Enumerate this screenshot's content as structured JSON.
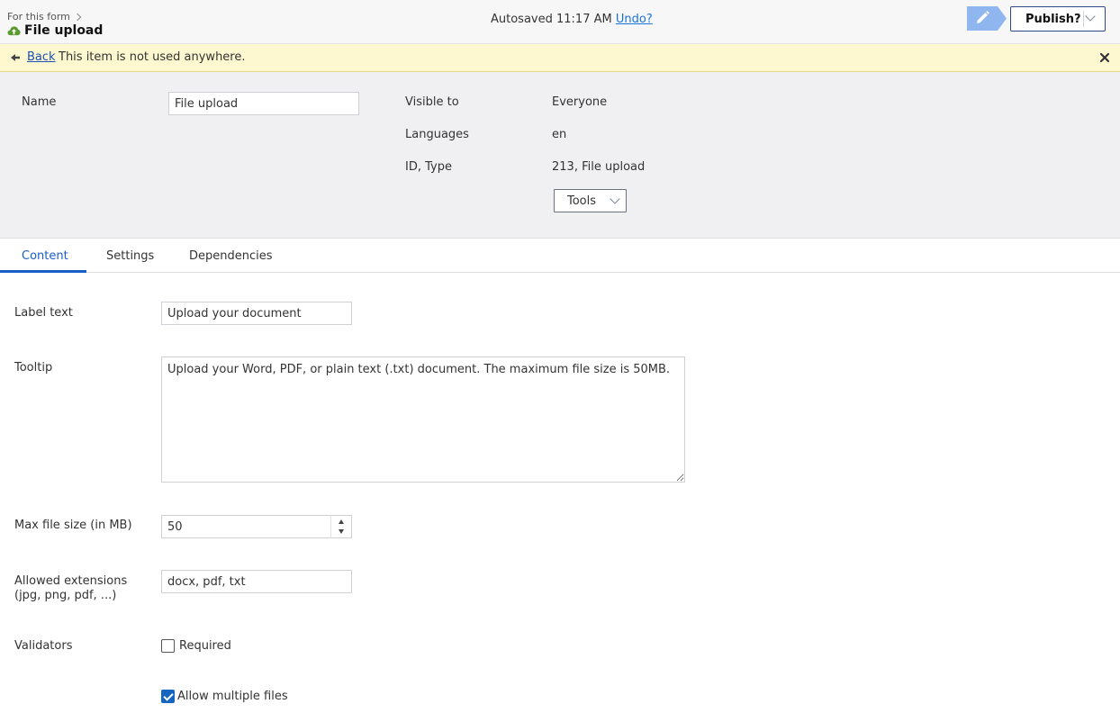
{
  "header": {
    "breadcrumb": "For this form",
    "title": "File upload",
    "autosave_text": "Autosaved 11:17 AM",
    "undo_label": "Undo?",
    "publish_label": "Publish?",
    "edit_icon": "pencil-icon"
  },
  "notice": {
    "back_label": "Back",
    "message": "This item is not used anywhere."
  },
  "properties": {
    "name_label": "Name",
    "name_value": "File upload",
    "visible_to_label": "Visible to",
    "visible_to_value": "Everyone",
    "languages_label": "Languages",
    "languages_value": "en",
    "id_type_label": "ID, Type",
    "id_type_value": "213, File upload",
    "tools_label": "Tools"
  },
  "tabs": [
    {
      "label": "Content",
      "active": true
    },
    {
      "label": "Settings",
      "active": false
    },
    {
      "label": "Dependencies",
      "active": false
    }
  ],
  "form": {
    "label_text_label": "Label text",
    "label_text_value": "Upload your document",
    "tooltip_label": "Tooltip",
    "tooltip_value": "Upload your Word, PDF, or plain text (.txt) document. The maximum file size is 50MB.",
    "max_size_label": "Max file size (in MB)",
    "max_size_value": "50",
    "extensions_label_line1": "Allowed extensions",
    "extensions_label_line2": "(jpg, png, pdf, ...)",
    "extensions_value": "docx, pdf, txt",
    "validators_label": "Validators",
    "required_label": "Required",
    "required_checked": false,
    "allow_multiple_label": "Allow multiple files",
    "allow_multiple_checked": true
  },
  "colors": {
    "accent": "#1a5fc8",
    "notice_bg": "#fdf8cf",
    "publish_border": "#2c4a86",
    "edit_button": "#8fb6ef"
  }
}
